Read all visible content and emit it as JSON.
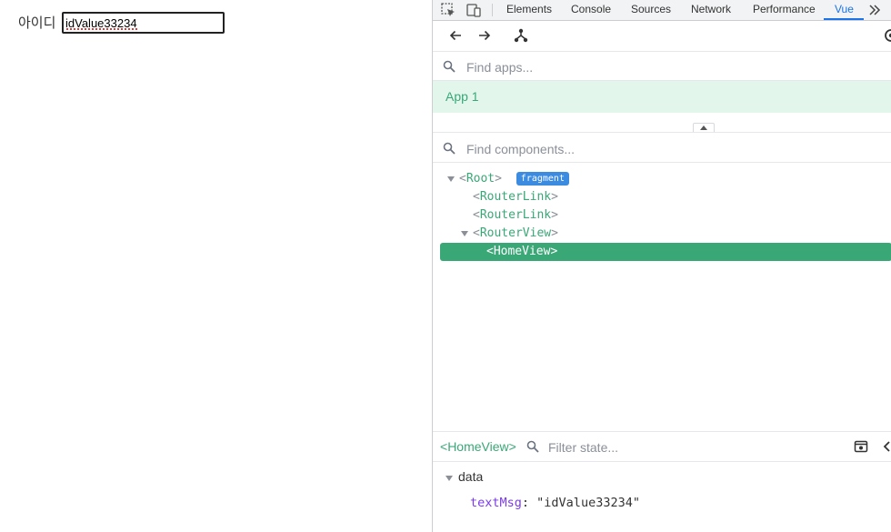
{
  "page": {
    "id_label": "아이디",
    "id_value": "idValue33234"
  },
  "devtools": {
    "tabs": [
      {
        "label": "Elements"
      },
      {
        "label": "Console"
      },
      {
        "label": "Sources"
      },
      {
        "label": "Network"
      },
      {
        "label": "Performance"
      },
      {
        "label": "Vue"
      }
    ],
    "active_tab": "Vue",
    "more_tabs_icon": "double-chevron-right-icon",
    "toolbar_icons": [
      "back-arrow-icon",
      "forward-arrow-icon",
      "component-tree-icon",
      "inspect-target-icon"
    ],
    "apps": {
      "placeholder": "Find apps...",
      "items": [
        {
          "label": "App 1"
        }
      ]
    },
    "components": {
      "placeholder": "Find components...",
      "tree": [
        {
          "name": "Root",
          "badge": "fragment"
        },
        {
          "name": "RouterLink"
        },
        {
          "name": "RouterLink"
        },
        {
          "name": "RouterView"
        },
        {
          "name": "HomeView",
          "selected": true
        }
      ]
    },
    "state": {
      "selected_component": "HomeView",
      "filter_placeholder": "Filter state...",
      "section": "data",
      "entries": [
        {
          "key": "textMsg",
          "value": "\"idValue33234\""
        }
      ]
    }
  },
  "colors": {
    "vue_green": "#3aa776",
    "app_row_bg": "#e2f6ec",
    "badge_blue": "#3b8be0",
    "active_tab": "#1a73e8"
  }
}
